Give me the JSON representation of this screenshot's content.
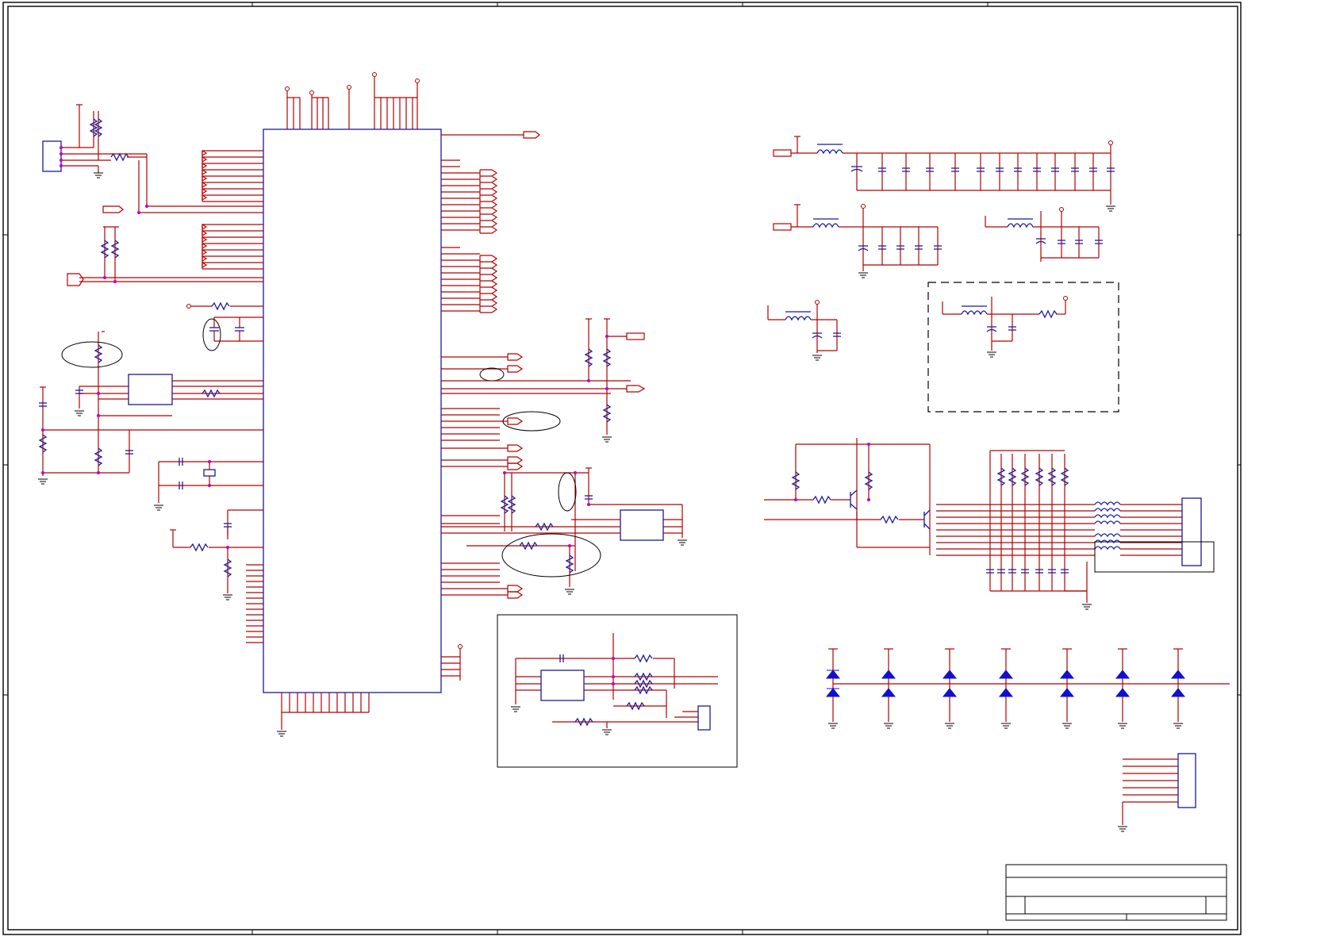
{
  "diagram": {
    "type": "schematic",
    "colors": {
      "wire": "#b40000",
      "component": "#1a1a9a",
      "junction": "#c000c0",
      "diode": "#1010d0",
      "frame": "#000000"
    },
    "title_block": {
      "rows": [
        "",
        "",
        ""
      ]
    }
  }
}
